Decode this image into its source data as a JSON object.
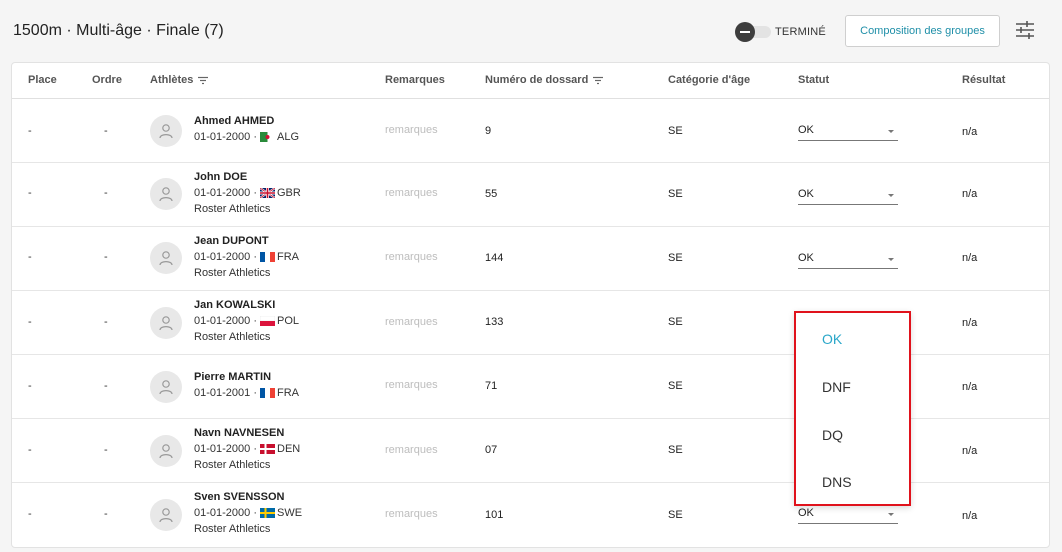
{
  "header": {
    "title": "1500m · Multi-âge · Finale (7)",
    "toggle_label": "TERMINÉ",
    "groups_button": "Composition des groupes"
  },
  "table": {
    "columns": {
      "place": "Place",
      "order": "Ordre",
      "athletes": "Athlètes",
      "remarks": "Remarques",
      "bib": "Numéro de dossard",
      "category": "Catégorie d'âge",
      "status": "Statut",
      "result": "Résultat"
    },
    "rows": [
      {
        "place": "-",
        "order": "-",
        "name": "Ahmed AHMED",
        "dob": "01-01-2000 ·",
        "country": "ALG",
        "club": "",
        "remarks": "remarques",
        "bib": "9",
        "category": "SE",
        "status": "OK",
        "result": "n/a"
      },
      {
        "place": "-",
        "order": "-",
        "name": "John DOE",
        "dob": "01-01-2000 ·",
        "country": "GBR",
        "club": "Roster Athletics",
        "remarks": "remarques",
        "bib": "55",
        "category": "SE",
        "status": "OK",
        "result": "n/a"
      },
      {
        "place": "-",
        "order": "-",
        "name": "Jean DUPONT",
        "dob": "01-01-2000 ·",
        "country": "FRA",
        "club": "Roster Athletics",
        "remarks": "remarques",
        "bib": "144",
        "category": "SE",
        "status": "OK",
        "result": "n/a"
      },
      {
        "place": "-",
        "order": "-",
        "name": "Jan KOWALSKI",
        "dob": "01-01-2000 ·",
        "country": "POL",
        "club": "Roster Athletics",
        "remarks": "remarques",
        "bib": "133",
        "category": "SE",
        "status": "",
        "result": "n/a"
      },
      {
        "place": "-",
        "order": "-",
        "name": "Pierre MARTIN",
        "dob": "01-01-2001 ·",
        "country": "FRA",
        "club": "",
        "remarks": "remarques",
        "bib": "71",
        "category": "SE",
        "status": "",
        "result": "n/a"
      },
      {
        "place": "-",
        "order": "-",
        "name": "Navn NAVNESEN",
        "dob": "01-01-2000 ·",
        "country": "DEN",
        "club": "Roster Athletics",
        "remarks": "remarques",
        "bib": "07",
        "category": "SE",
        "status": "",
        "result": "n/a"
      },
      {
        "place": "-",
        "order": "-",
        "name": "Sven SVENSSON",
        "dob": "01-01-2000 ·",
        "country": "SWE",
        "club": "Roster Athletics",
        "remarks": "remarques",
        "bib": "101",
        "category": "SE",
        "status": "OK",
        "result": "n/a"
      }
    ]
  },
  "status_dropdown": {
    "options": [
      "OK",
      "DNF",
      "DQ",
      "DNS"
    ],
    "selected": "OK"
  },
  "colors": {
    "accent": "#1f8fa8",
    "selected_option": "#2aa7c9",
    "highlight_border": "#e0121c"
  }
}
